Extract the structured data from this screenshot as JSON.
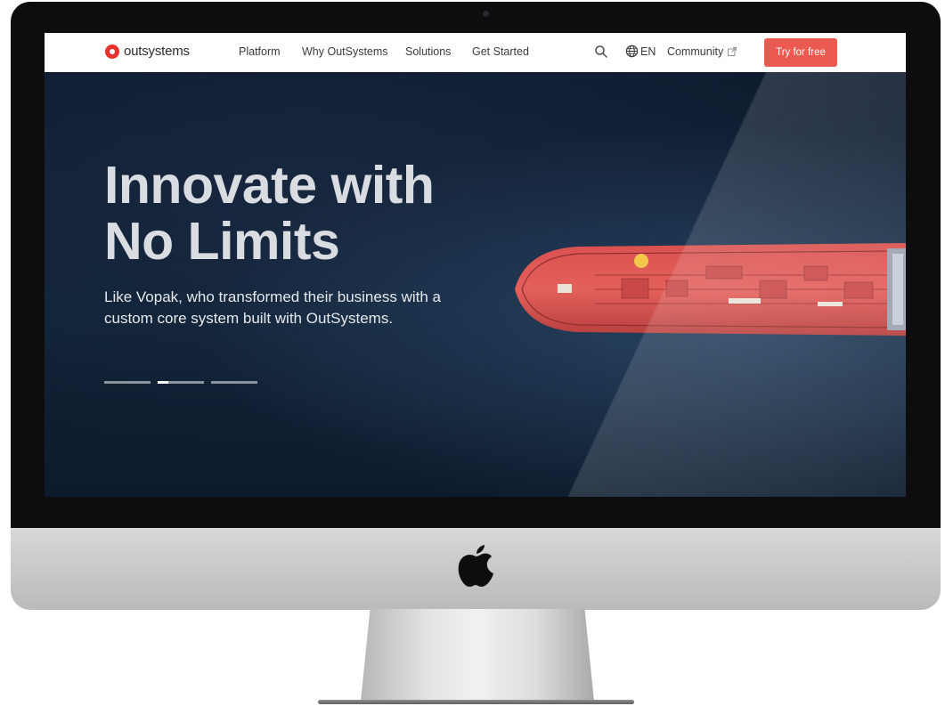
{
  "nav": {
    "logo_text": "outsystems",
    "links": [
      "Platform",
      "Why OutSystems",
      "Solutions",
      "Get Started"
    ],
    "lang": "EN",
    "community": "Community",
    "cta": "Try for free"
  },
  "hero": {
    "title_line1": "Innovate with",
    "title_line2": "No Limits",
    "subtitle_line1": "Like Vopak, who transformed their business with a",
    "subtitle_line2": "custom core system built with OutSystems.",
    "carousel_active_index": 1,
    "carousel_count": 3
  },
  "colors": {
    "brand": "#e6322c",
    "cta": "#ea5a50",
    "hero_bg": "#0f1c30"
  },
  "icons": [
    "search-icon",
    "globe-icon",
    "external-link-icon",
    "apple-logo-icon"
  ]
}
